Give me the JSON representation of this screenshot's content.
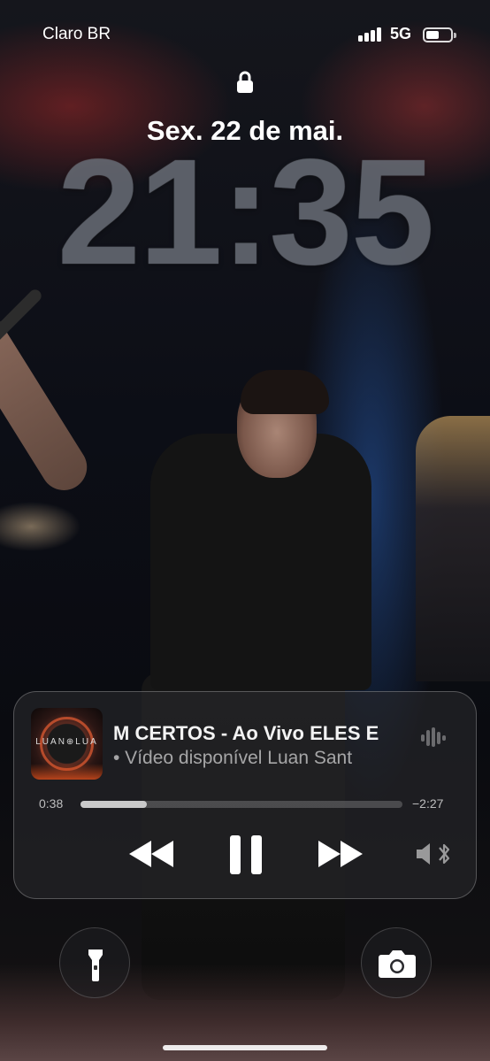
{
  "status_bar": {
    "carrier": "Claro BR",
    "network": "5G",
    "battery_level": 0.55
  },
  "lock_screen": {
    "date": "Sex. 22 de mai.",
    "time": "21:35"
  },
  "now_playing": {
    "artwork_label": "LUAN⊕LUA",
    "title": "M CERTOS - Ao Vivo      ELES E",
    "subtitle": "• Vídeo disponível      Luan Sant",
    "elapsed": "0:38",
    "remaining": "−2:27",
    "progress": 0.205
  },
  "quick_actions": {
    "left_icon": "flashlight-icon",
    "right_icon": "camera-icon"
  }
}
